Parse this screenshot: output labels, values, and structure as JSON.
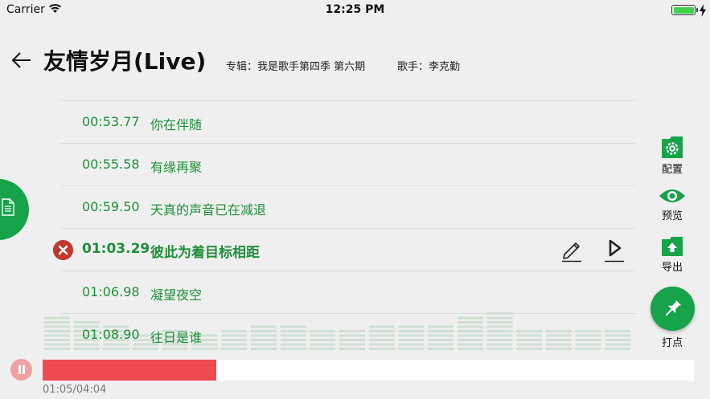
{
  "status_bar": {
    "carrier": "Carrier",
    "time": "12:25 PM",
    "battery_level": 1.0,
    "wifi_icon": "wifi-icon",
    "charging_icon": "charging-bolt-icon"
  },
  "header": {
    "back_icon": "arrow-left-icon",
    "title": "友情岁月(Live)",
    "album": "专辑：我是歌手第四季 第六期",
    "singer": "歌手：李克勤"
  },
  "lyrics": [
    {
      "time": "00:53.77",
      "text": "你在伴随",
      "active": false
    },
    {
      "time": "00:55.58",
      "text": "有缘再聚",
      "active": false
    },
    {
      "time": "00:59.50",
      "text": "天真的声音已在减退",
      "active": false
    },
    {
      "time": "01:03.29",
      "text": "彼此为着目标相距",
      "active": true
    },
    {
      "time": "01:06.98",
      "text": "凝望夜空",
      "active": false
    },
    {
      "time": "01:08.90",
      "text": "往日是谁",
      "active": false
    }
  ],
  "active_row_icons": {
    "delete": "delete-x-icon",
    "edit": "pencil-icon",
    "play": "play-line-icon"
  },
  "toolbar": {
    "config_label": "配置",
    "preview_label": "预览",
    "export_label": "导出",
    "mark_label": "打点"
  },
  "playback": {
    "current": "01:05",
    "total": "04:04",
    "readout": "01:05/04:04",
    "progress": 0.267
  },
  "colors": {
    "accent_green": "#16a34a",
    "lyric_green": "#1f8f3a",
    "progress_red": "#ef4a4f",
    "delete_red": "#c0392b"
  }
}
